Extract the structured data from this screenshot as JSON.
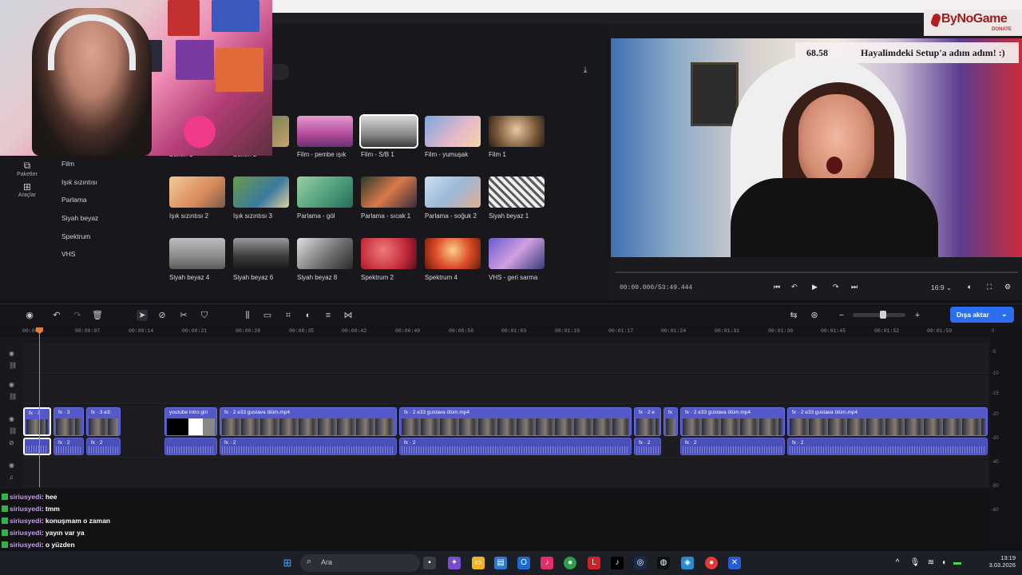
{
  "sidebar": {
    "items": [
      {
        "label": "Paketler",
        "icon": "package-icon"
      },
      {
        "label": "Araçlar",
        "icon": "tools-icon"
      }
    ],
    "categories": [
      "Film",
      "Işık sızıntısı",
      "Parlama",
      "Siyah beyaz",
      "Spektrum",
      "VHS"
    ]
  },
  "filters": {
    "row1": [
      {
        "label": "Bokeh 1"
      },
      {
        "label": "Bokeh 2"
      },
      {
        "label": "Film - pembe ışık"
      },
      {
        "label": "Film - S/B 1"
      },
      {
        "label": "Film - yumuşak"
      },
      {
        "label": "Film 1"
      }
    ],
    "row2": [
      {
        "label": "Işık sızıntısı 2"
      },
      {
        "label": "Işık sızıntısı 3"
      },
      {
        "label": "Parlama - göl"
      },
      {
        "label": "Parlama - sıcak 1"
      },
      {
        "label": "Parlama - soğuk 2"
      },
      {
        "label": "Siyah beyaz 1"
      }
    ],
    "row3": [
      {
        "label": "Siyah beyaz 4"
      },
      {
        "label": "Siyah beyaz 6"
      },
      {
        "label": "Siyah beyaz 8"
      },
      {
        "label": "Spektrum 2"
      },
      {
        "label": "Spektrum 4"
      },
      {
        "label": "VHS - geri sarma"
      }
    ]
  },
  "stream_overlay": {
    "logo": "ByNoGame",
    "logo_sub": "DONATE",
    "number": "68.58",
    "message": "Hayalimdeki Setup'a adım adım! :)"
  },
  "preview": {
    "timecode": "00:00.000/53:49.444",
    "aspect": "16:9"
  },
  "toolbar": {
    "export_label": "Dışa aktar"
  },
  "ruler": [
    "00:00",
    "00:00:07",
    "00:00:14",
    "00:00:21",
    "00:00:28",
    "00:00:35",
    "00:00:42",
    "00:00:49",
    "00:00:56",
    "00:01:03",
    "00:01:10",
    "00:01:17",
    "00:01:24",
    "00:01:31",
    "00:01:38",
    "00:01:45",
    "00:01:52",
    "00:01:59"
  ],
  "meter_labels": [
    "0",
    "-5",
    "-10",
    "-15",
    "-20",
    "-30",
    "-40",
    "-50",
    "-60"
  ],
  "clips": {
    "video": [
      {
        "title": "fx · 3"
      },
      {
        "title": "fx · 3"
      },
      {
        "title": "fx · 3  e3:"
      },
      {
        "title": "youtube intro giri"
      },
      {
        "title": "fx · 2  e33 gustava ölüm.mp4"
      },
      {
        "title": "fx · 2  e33 gustava ölüm.mp4"
      },
      {
        "title": "fx · 2  e"
      },
      {
        "title": "fx"
      },
      {
        "title": "fx · 2  e33 gustava ölüm.mp4"
      },
      {
        "title": "fx · 2  e33 gustava ölüm.mp4"
      }
    ],
    "audio": [
      {
        "title": ""
      },
      {
        "title": "fx · 2"
      },
      {
        "title": "fx · 2"
      },
      {
        "title": ""
      },
      {
        "title": "fx · 2"
      },
      {
        "title": "fx · 2"
      },
      {
        "title": "fx · 2"
      },
      {
        "title": "fx · 2"
      },
      {
        "title": "fx · 2"
      }
    ]
  },
  "chat": [
    {
      "user": "siriusyedi",
      "msg": ": hee"
    },
    {
      "user": "siriusyedi",
      "msg": ": tmm"
    },
    {
      "user": "siriusyedi",
      "msg": ": konuşmam o zaman"
    },
    {
      "user": "siriusyedi",
      "msg": ": yayın var ya"
    },
    {
      "user": "siriusyedi",
      "msg": ": o yüzden"
    }
  ],
  "taskbar": {
    "search_label": "Ara",
    "time": "13:19",
    "date": "3.03.2026"
  }
}
